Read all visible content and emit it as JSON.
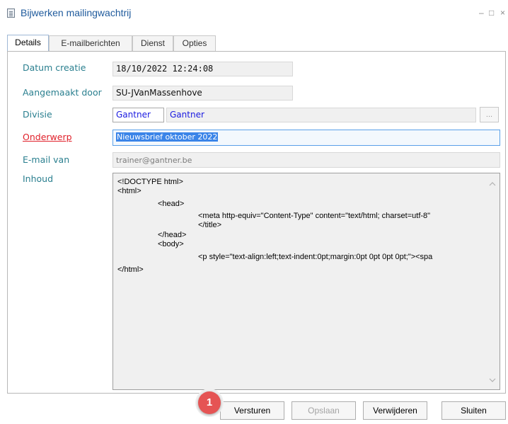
{
  "window": {
    "title": "Bijwerken mailingwachtrij",
    "minimize": "–",
    "maximize": "□",
    "close": "×",
    "icon": "document-list-icon"
  },
  "tabs": [
    {
      "label": "Details",
      "active": true
    },
    {
      "label": "E-mailberichten",
      "active": false
    },
    {
      "label": "Dienst",
      "active": false
    },
    {
      "label": "Opties",
      "active": false
    }
  ],
  "form": {
    "datum_creatie": {
      "label": "Datum creatie",
      "value": "18/10/2022 12:24:08"
    },
    "aangemaakt_door": {
      "label": "Aangemaakt door",
      "value": "SU-JVanMassenhove"
    },
    "divisie": {
      "label": "Divisie",
      "code": "Gantner",
      "name": "Gantner",
      "lookup": "..."
    },
    "onderwerp": {
      "label": "Onderwerp",
      "value": "Nieuwsbrief oktober 2022"
    },
    "email_van": {
      "label": "E-mail van",
      "value": "trainer@gantner.be"
    },
    "inhoud": {
      "label": "Inhoud",
      "lines": [
        "<!DOCTYPE html>",
        "<html>",
        "<head>",
        "<meta http-equiv=\"Content-Type\" content=\"text/html; charset=utf-8\"",
        "</title>",
        "</head>",
        "<body>",
        "<p style=\"text-align:left;text-indent:0pt;margin:0pt 0pt 0pt 0pt;\"><spa",
        "</html>"
      ]
    }
  },
  "buttons": {
    "versturen": "Versturen",
    "opslaan": "Opslaan",
    "verwijderen": "Verwijderen",
    "sluiten": "Sluiten"
  },
  "badge": {
    "number": "1"
  },
  "colors": {
    "label": "#2a7f8f",
    "required_label": "#e0202a",
    "title": "#1e5a9c",
    "badge": "#e55454",
    "selection": "#3a84e8"
  }
}
